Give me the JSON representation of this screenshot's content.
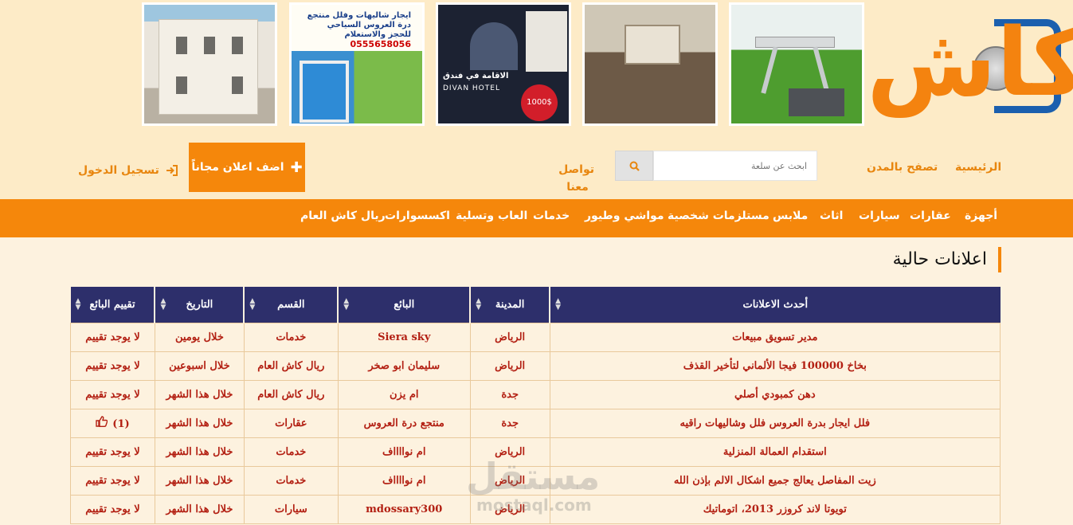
{
  "header": {
    "logo_text": "كاش",
    "banner2_text": "ايجار شاليهات وفلل منتجع درة العروس السياحي للحجز والاستعلام",
    "banner2_phone": "0555658056",
    "banner3_hotel_ar": "الاقامة في فندق",
    "banner3_hotel_en": "DIVAN HOTEL",
    "banner3_price": "1000$"
  },
  "nav": {
    "home": "الرئيسية",
    "browse_cities": "تصفح بالمدن",
    "contact": "تواصل معنا",
    "search_placeholder": "ابحث عن سلعة",
    "add_ad": "اضف اعلان مجاناً",
    "login": "تسجيل الدخول"
  },
  "categories": [
    "أجهزة",
    "عقارات",
    "سيارات",
    "اثاث",
    "ملابس",
    "مستلزمات شخصية",
    "مواشي وطيور",
    "خدمات",
    "العاب وتسلية",
    "اكسسوارات",
    "ريال كاش العام"
  ],
  "section_title": "اعلانات حالية",
  "table": {
    "headers": [
      "أحدث الاعلانات",
      "المدينة",
      "البائع",
      "القسم",
      "التاريخ",
      "تقييم البائع"
    ],
    "rows": [
      [
        "مدير تسويق مبيعات",
        "الرياض",
        "Siera sky",
        "خدمات",
        "خلال يومين",
        "لا يوجد تقييم"
      ],
      [
        "بخاخ 100000 فيجا الألماني لتأخير القذف",
        "الرياض",
        "سليمان ابو صخر",
        "ريال كاش العام",
        "خلال اسبوعين",
        "لا يوجد تقييم"
      ],
      [
        "دهن كمبودي أصلي",
        "جدة",
        "ام يزن",
        "ريال كاش العام",
        "خلال هذا الشهر",
        "لا يوجد تقييم"
      ],
      [
        "فلل ايجار بدرة العروس فلل وشاليهات راقيه",
        "جدة",
        "منتجع درة العروس",
        "عقارات",
        "خلال هذا الشهر",
        "(1)"
      ],
      [
        "استقدام العمالة المنزلية",
        "الرياض",
        "ام نوااااف",
        "خدمات",
        "خلال هذا الشهر",
        "لا يوجد تقييم"
      ],
      [
        "زيت المفاصل يعالج جميع اشكال الالم بإذن الله",
        "الرياض",
        "ام نوااااف",
        "خدمات",
        "خلال هذا الشهر",
        "لا يوجد تقييم"
      ],
      [
        "تويوتا لاند كروزر 2013، اتوماتيك",
        "الرياض",
        "mdossary300",
        "سيارات",
        "خلال هذا الشهر",
        "لا يوجد تقييم"
      ]
    ]
  },
  "watermark": {
    "ar": "مستقل",
    "en": "mostaql.com"
  },
  "colors": {
    "accent": "#f5870b",
    "header_bg": "#fdebc7",
    "table_head": "#2d2f6b",
    "cell_text": "#b32013",
    "logo_blue": "#1b5fae"
  }
}
